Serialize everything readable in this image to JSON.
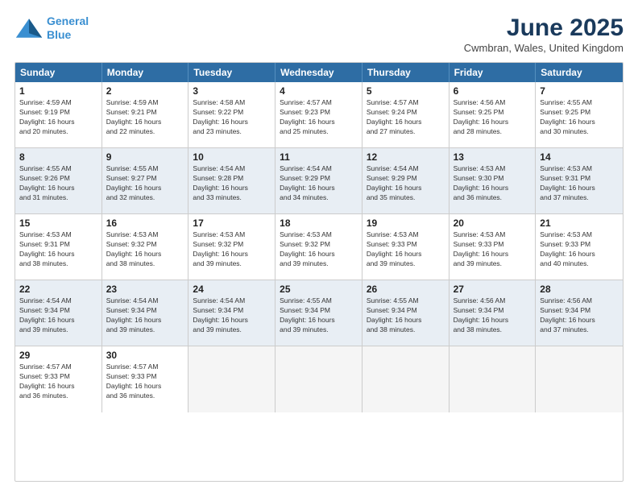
{
  "header": {
    "logo_line1": "General",
    "logo_line2": "Blue",
    "month": "June 2025",
    "location": "Cwmbran, Wales, United Kingdom"
  },
  "weekdays": [
    "Sunday",
    "Monday",
    "Tuesday",
    "Wednesday",
    "Thursday",
    "Friday",
    "Saturday"
  ],
  "rows": [
    {
      "cells": [
        {
          "day": "1",
          "text": "Sunrise: 4:59 AM\nSunset: 9:19 PM\nDaylight: 16 hours\nand 20 minutes."
        },
        {
          "day": "2",
          "text": "Sunrise: 4:59 AM\nSunset: 9:21 PM\nDaylight: 16 hours\nand 22 minutes."
        },
        {
          "day": "3",
          "text": "Sunrise: 4:58 AM\nSunset: 9:22 PM\nDaylight: 16 hours\nand 23 minutes."
        },
        {
          "day": "4",
          "text": "Sunrise: 4:57 AM\nSunset: 9:23 PM\nDaylight: 16 hours\nand 25 minutes."
        },
        {
          "day": "5",
          "text": "Sunrise: 4:57 AM\nSunset: 9:24 PM\nDaylight: 16 hours\nand 27 minutes."
        },
        {
          "day": "6",
          "text": "Sunrise: 4:56 AM\nSunset: 9:25 PM\nDaylight: 16 hours\nand 28 minutes."
        },
        {
          "day": "7",
          "text": "Sunrise: 4:55 AM\nSunset: 9:25 PM\nDaylight: 16 hours\nand 30 minutes."
        }
      ]
    },
    {
      "cells": [
        {
          "day": "8",
          "text": "Sunrise: 4:55 AM\nSunset: 9:26 PM\nDaylight: 16 hours\nand 31 minutes."
        },
        {
          "day": "9",
          "text": "Sunrise: 4:55 AM\nSunset: 9:27 PM\nDaylight: 16 hours\nand 32 minutes."
        },
        {
          "day": "10",
          "text": "Sunrise: 4:54 AM\nSunset: 9:28 PM\nDaylight: 16 hours\nand 33 minutes."
        },
        {
          "day": "11",
          "text": "Sunrise: 4:54 AM\nSunset: 9:29 PM\nDaylight: 16 hours\nand 34 minutes."
        },
        {
          "day": "12",
          "text": "Sunrise: 4:54 AM\nSunset: 9:29 PM\nDaylight: 16 hours\nand 35 minutes."
        },
        {
          "day": "13",
          "text": "Sunrise: 4:53 AM\nSunset: 9:30 PM\nDaylight: 16 hours\nand 36 minutes."
        },
        {
          "day": "14",
          "text": "Sunrise: 4:53 AM\nSunset: 9:31 PM\nDaylight: 16 hours\nand 37 minutes."
        }
      ]
    },
    {
      "cells": [
        {
          "day": "15",
          "text": "Sunrise: 4:53 AM\nSunset: 9:31 PM\nDaylight: 16 hours\nand 38 minutes."
        },
        {
          "day": "16",
          "text": "Sunrise: 4:53 AM\nSunset: 9:32 PM\nDaylight: 16 hours\nand 38 minutes."
        },
        {
          "day": "17",
          "text": "Sunrise: 4:53 AM\nSunset: 9:32 PM\nDaylight: 16 hours\nand 39 minutes."
        },
        {
          "day": "18",
          "text": "Sunrise: 4:53 AM\nSunset: 9:32 PM\nDaylight: 16 hours\nand 39 minutes."
        },
        {
          "day": "19",
          "text": "Sunrise: 4:53 AM\nSunset: 9:33 PM\nDaylight: 16 hours\nand 39 minutes."
        },
        {
          "day": "20",
          "text": "Sunrise: 4:53 AM\nSunset: 9:33 PM\nDaylight: 16 hours\nand 39 minutes."
        },
        {
          "day": "21",
          "text": "Sunrise: 4:53 AM\nSunset: 9:33 PM\nDaylight: 16 hours\nand 40 minutes."
        }
      ]
    },
    {
      "cells": [
        {
          "day": "22",
          "text": "Sunrise: 4:54 AM\nSunset: 9:34 PM\nDaylight: 16 hours\nand 39 minutes."
        },
        {
          "day": "23",
          "text": "Sunrise: 4:54 AM\nSunset: 9:34 PM\nDaylight: 16 hours\nand 39 minutes."
        },
        {
          "day": "24",
          "text": "Sunrise: 4:54 AM\nSunset: 9:34 PM\nDaylight: 16 hours\nand 39 minutes."
        },
        {
          "day": "25",
          "text": "Sunrise: 4:55 AM\nSunset: 9:34 PM\nDaylight: 16 hours\nand 39 minutes."
        },
        {
          "day": "26",
          "text": "Sunrise: 4:55 AM\nSunset: 9:34 PM\nDaylight: 16 hours\nand 38 minutes."
        },
        {
          "day": "27",
          "text": "Sunrise: 4:56 AM\nSunset: 9:34 PM\nDaylight: 16 hours\nand 38 minutes."
        },
        {
          "day": "28",
          "text": "Sunrise: 4:56 AM\nSunset: 9:34 PM\nDaylight: 16 hours\nand 37 minutes."
        }
      ]
    },
    {
      "cells": [
        {
          "day": "29",
          "text": "Sunrise: 4:57 AM\nSunset: 9:33 PM\nDaylight: 16 hours\nand 36 minutes."
        },
        {
          "day": "30",
          "text": "Sunrise: 4:57 AM\nSunset: 9:33 PM\nDaylight: 16 hours\nand 36 minutes."
        },
        {
          "day": "",
          "text": ""
        },
        {
          "day": "",
          "text": ""
        },
        {
          "day": "",
          "text": ""
        },
        {
          "day": "",
          "text": ""
        },
        {
          "day": "",
          "text": ""
        }
      ]
    }
  ]
}
